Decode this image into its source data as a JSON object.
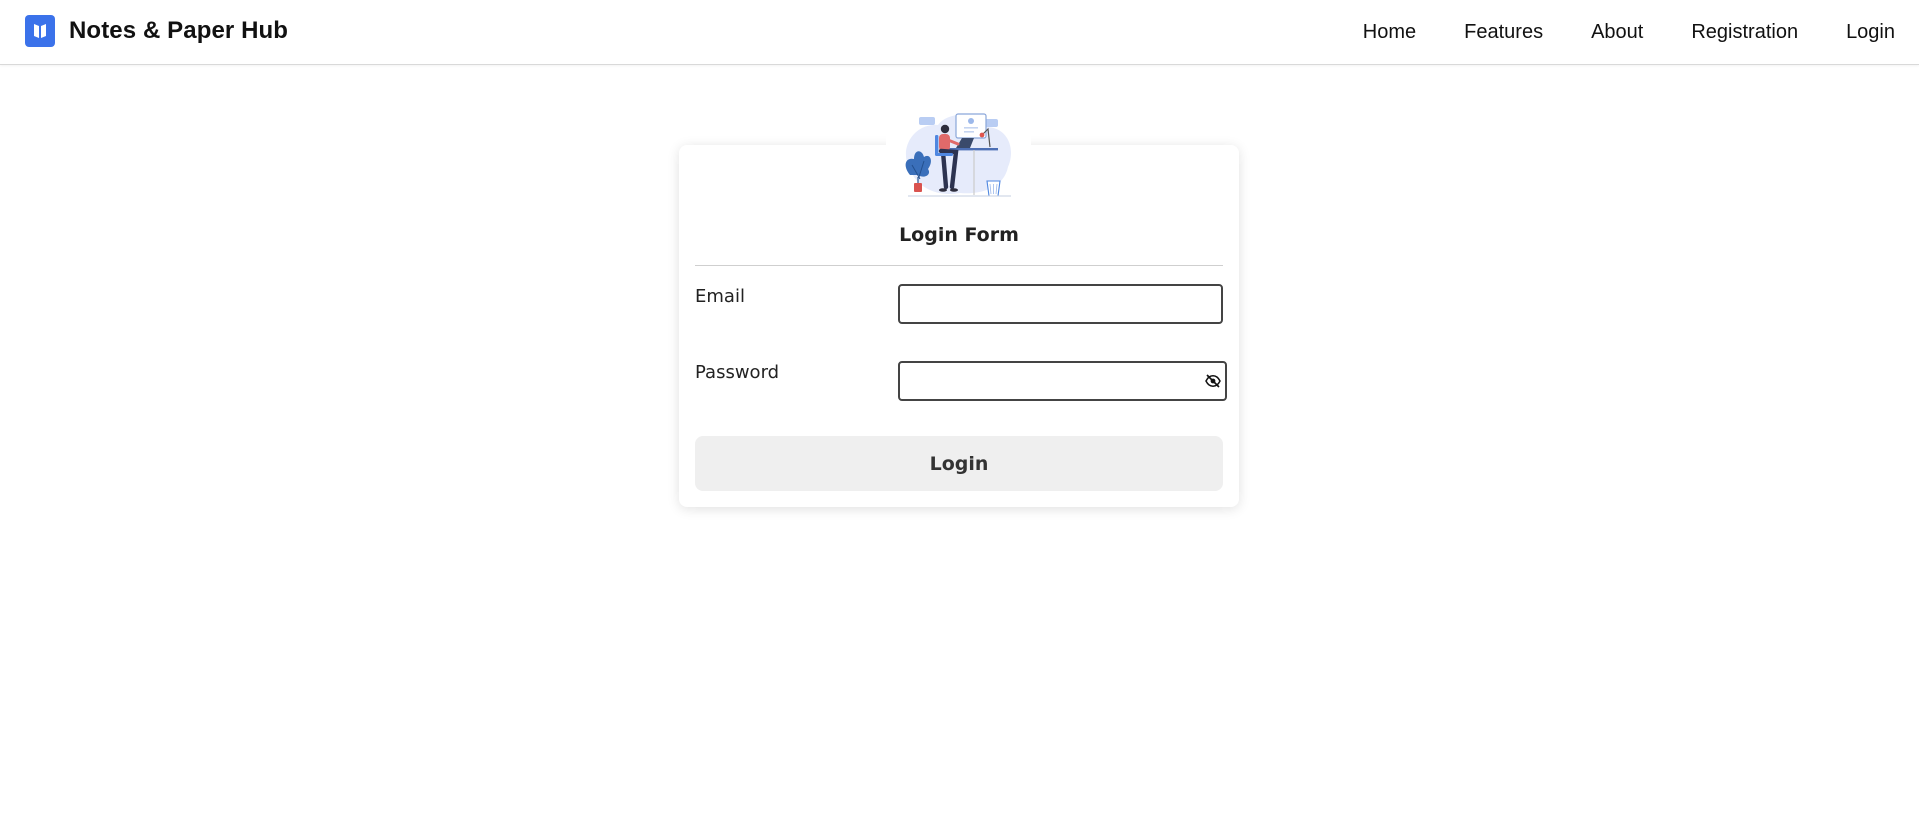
{
  "header": {
    "brand_title": "Notes & Paper Hub",
    "logo_icon": "bookmark-icon",
    "nav": [
      {
        "label": "Home"
      },
      {
        "label": "Features"
      },
      {
        "label": "About"
      },
      {
        "label": "Registration"
      },
      {
        "label": "Login"
      }
    ]
  },
  "login_form": {
    "title": "Login Form",
    "illustration": "person-at-desk-illustration",
    "email": {
      "label": "Email",
      "value": "",
      "placeholder": ""
    },
    "password": {
      "label": "Password",
      "value": "",
      "placeholder": "",
      "toggle_icon": "eye-slash-icon"
    },
    "submit_label": "Login"
  },
  "colors": {
    "brand_accent": "#3b72ea",
    "button_bg": "#efefef",
    "text": "#111111"
  }
}
